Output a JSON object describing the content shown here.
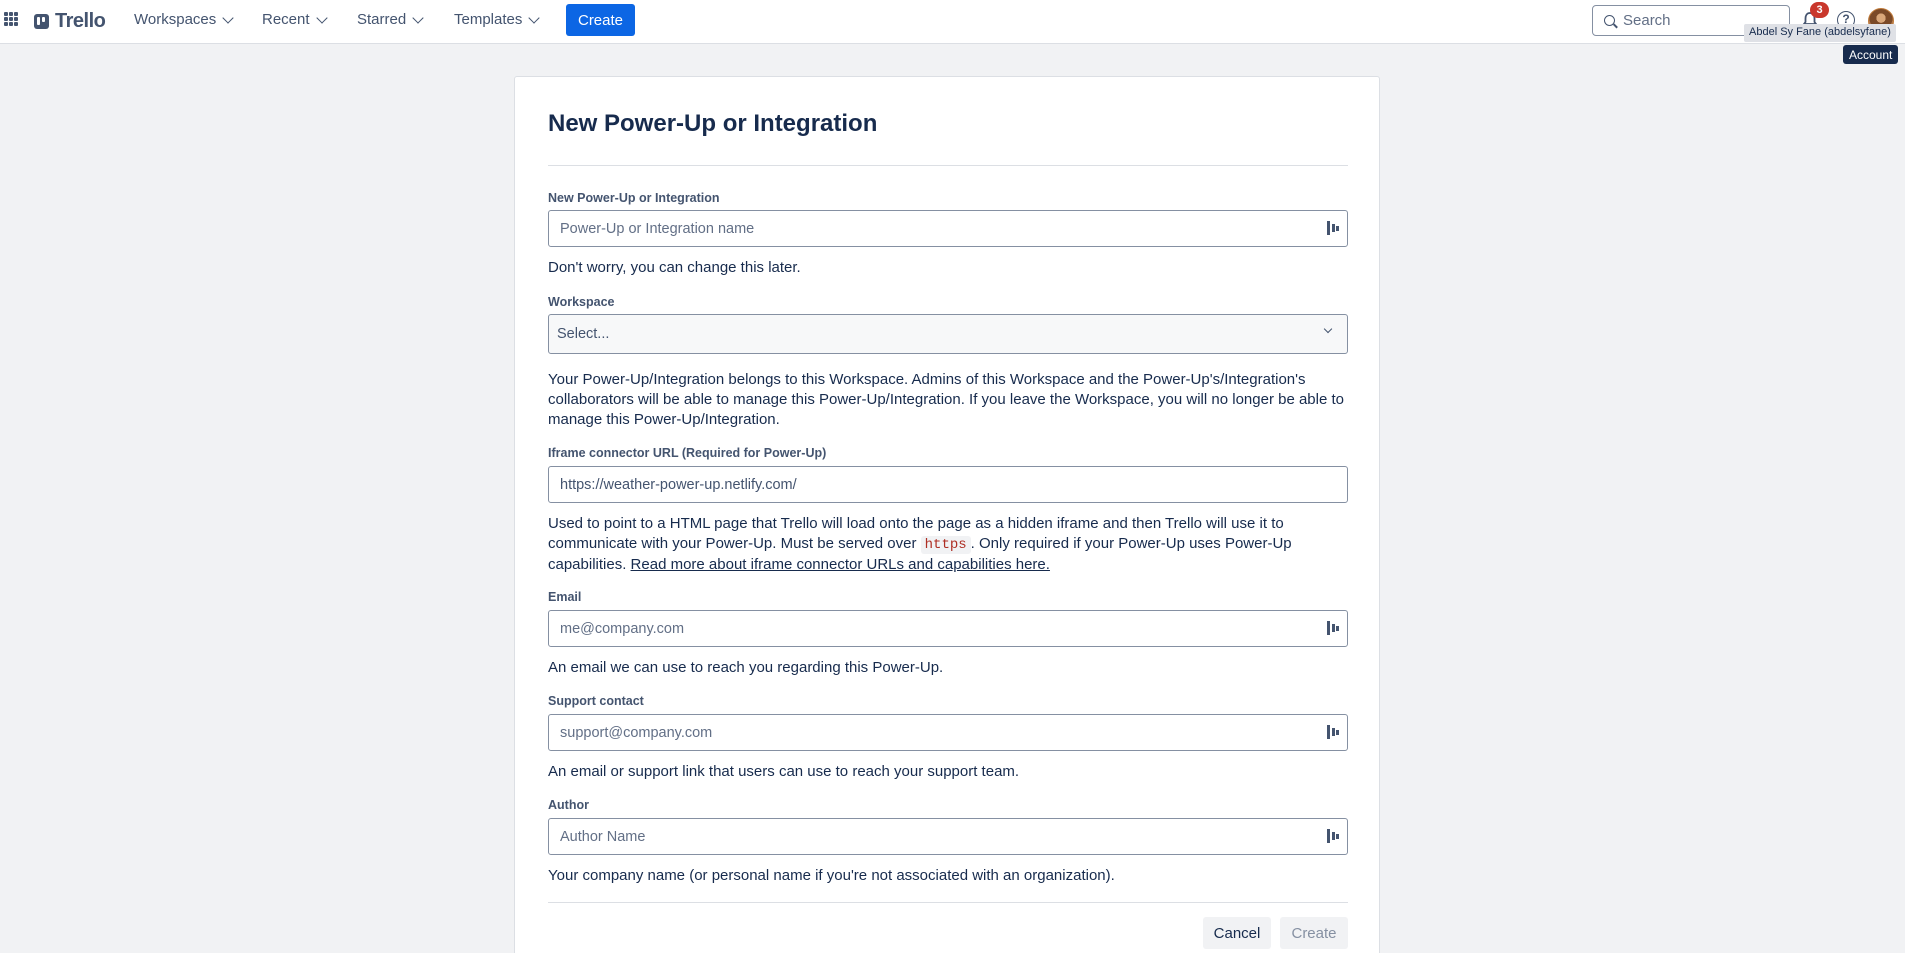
{
  "header": {
    "brand": "Trello",
    "nav": [
      "Workspaces",
      "Recent",
      "Starred",
      "Templates"
    ],
    "create_label": "Create",
    "search_placeholder": "Search",
    "notification_count": "3",
    "help_glyph": "?",
    "tooltip_user": "Abdel Sy Fane (abdelsyfane)",
    "tooltip_account": "Account"
  },
  "form": {
    "title": "New Power-Up or Integration",
    "name": {
      "label": "New Power-Up or Integration",
      "placeholder": "Power-Up or Integration name",
      "help": "Don't worry, you can change this later."
    },
    "workspace": {
      "label": "Workspace",
      "value": "Select...",
      "help": "Your Power-Up/Integration belongs to this Workspace. Admins of this Workspace and the Power-Up's/Integration's collaborators will be able to manage this Power-Up/Integration. If you leave the Workspace, you will no longer be able to manage this Power-Up/Integration."
    },
    "iframe": {
      "label": "Iframe connector URL (Required for Power-Up)",
      "value": "https://weather-power-up.netlify.com/",
      "help_part1": "Used to point to a HTML page that Trello will load onto the page as a hidden iframe and then Trello will use it to communicate with your Power-Up. Must be served over ",
      "help_code": "https",
      "help_part2": ". Only required if your Power-Up uses Power-Up capabilities. ",
      "help_link": "Read more about iframe connector URLs and capabilities here."
    },
    "email": {
      "label": "Email",
      "placeholder": "me@company.com",
      "help": "An email we can use to reach you regarding this Power-Up."
    },
    "support": {
      "label": "Support contact",
      "placeholder": "support@company.com",
      "help": "An email or support link that users can use to reach your support team."
    },
    "author": {
      "label": "Author",
      "placeholder": "Author Name",
      "help": "Your company name (or personal name if you're not associated with an organization)."
    },
    "cancel_label": "Cancel",
    "create_label": "Create"
  }
}
